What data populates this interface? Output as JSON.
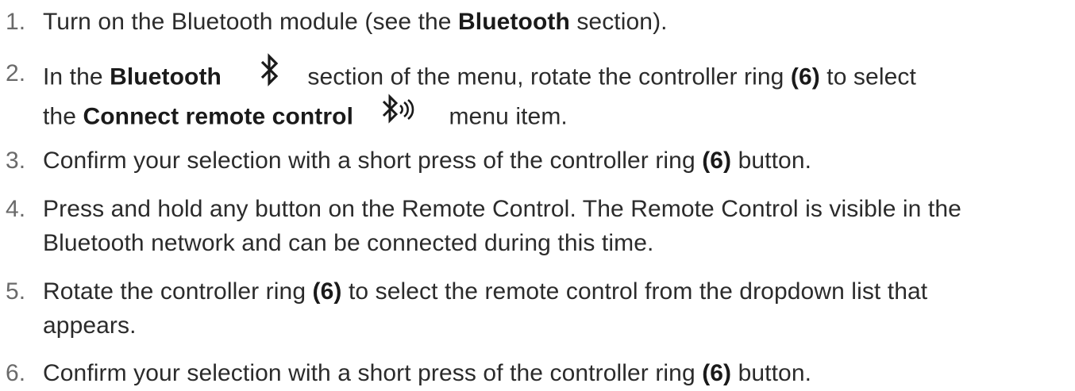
{
  "steps": [
    {
      "number": "1.",
      "parts": [
        "Turn on the Bluetooth module (see the ",
        "Bluetooth",
        " section)."
      ]
    },
    {
      "number": "2.",
      "parts": [
        "In the ",
        "Bluetooth",
        " section of the menu, rotate the controller ring ",
        "(6)",
        " to select"
      ],
      "line2_parts": [
        "the ",
        "Connect remote control",
        " menu item."
      ],
      "icon": "bluetooth-icon",
      "icon2": "bluetooth-connect-remote-icon"
    },
    {
      "number": "3.",
      "parts": [
        "Confirm your selection with a short press of the controller ring ",
        "(6)",
        " button."
      ]
    },
    {
      "number": "4.",
      "line1": "Press and hold any button on the Remote Control. The Remote Control is visible in the",
      "line2": "Bluetooth network and can be connected during this time."
    },
    {
      "number": "5.",
      "parts": [
        "Rotate the controller ring ",
        "(6)",
        " to select the remote control from the dropdown list that"
      ],
      "line2": "appears."
    },
    {
      "number": "6.",
      "parts": [
        "Confirm your selection with a short press of the controller ring ",
        "(6)",
        " button."
      ]
    }
  ],
  "colors": {
    "text": "#2b2b2b",
    "number": "#6a6a6a",
    "bold": "#1a1a1a"
  }
}
